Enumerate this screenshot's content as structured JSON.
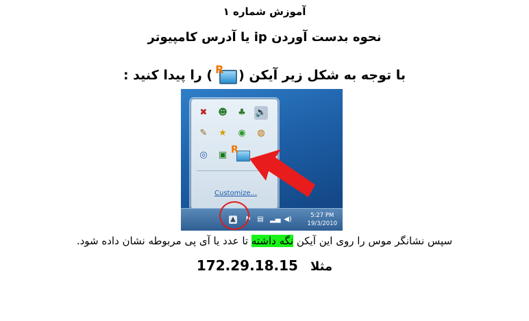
{
  "heading": "آموزش شماره ۱",
  "subtitle": "نحوه بدست آوردن ip یا آدرس کامپیوتر",
  "instruction": {
    "before": "با توجه به شکل زیر آیکن (",
    "after": ") را پیدا کنید :",
    "icon": "remote-network-icon"
  },
  "screenshot": {
    "customize_link": "Customize...",
    "clock_time": "5:27 PM",
    "clock_date": "19/3/2010",
    "arrow_color": "#e81c1c",
    "circle_color": "#e01b1b"
  },
  "description": {
    "before": "سپس نشانگر موس را روی این آیکن ",
    "highlight": "نگه داشته",
    "after": " تا عدد یا آی پی مربوطه نشان داده شود.",
    "highlight_color": "#19f219"
  },
  "example": {
    "ip": "172.29.18.15",
    "label": "مثلا"
  }
}
